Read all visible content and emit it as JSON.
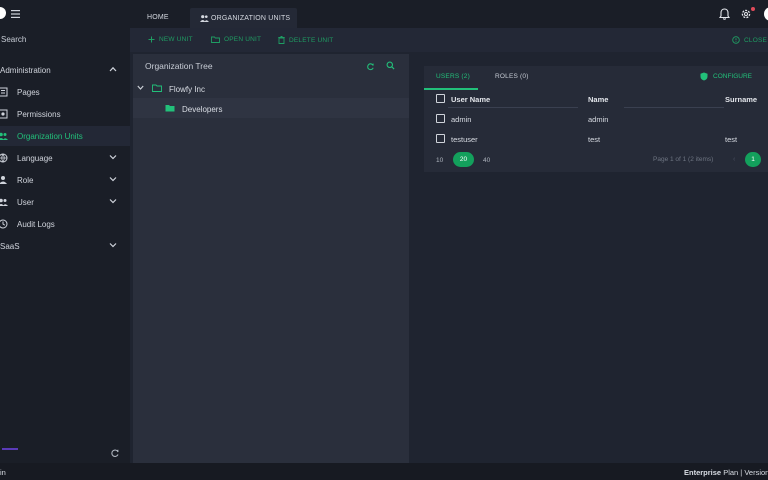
{
  "header": {
    "tabs": [
      {
        "label": "HOME"
      },
      {
        "label": "ORGANIZATION UNITS"
      }
    ]
  },
  "sidebar": {
    "search_label": "Search",
    "items": [
      {
        "label": "Administration",
        "icon": "chevron-up-icon"
      },
      {
        "label": "Pages",
        "icon": "pages-icon"
      },
      {
        "label": "Permissions",
        "icon": "permissions-icon"
      },
      {
        "label": "Organization Units",
        "icon": "org-units-icon",
        "active": true
      },
      {
        "label": "Language",
        "icon": "globe-icon"
      },
      {
        "label": "Role",
        "icon": "role-icon"
      },
      {
        "label": "User",
        "icon": "users-icon"
      },
      {
        "label": "Audit Logs",
        "icon": "clock-icon"
      },
      {
        "label": "SaaS",
        "icon": "chevron-down-icon"
      }
    ]
  },
  "toolbar": {
    "new_unit": "NEW UNIT",
    "open_unit": "OPEN UNIT",
    "delete_unit": "DELETE UNIT",
    "close": "CLOSE"
  },
  "tree": {
    "title": "Organization Tree",
    "nodes": [
      {
        "label": "Flowfy Inc"
      },
      {
        "label": "Developers"
      }
    ]
  },
  "members": {
    "tab_users": "USERS (2)",
    "tab_roles": "ROLES (0)",
    "configure": "CONFIGURE",
    "columns": [
      "User Name",
      "Name",
      "Surname"
    ],
    "rows": [
      {
        "username": "admin",
        "name": "admin",
        "surname": ""
      },
      {
        "username": "testuser",
        "name": "test",
        "surname": "test"
      }
    ],
    "page_sizes": [
      "10",
      "20",
      "40"
    ],
    "page_info": "Page 1 of 1 (2 items)",
    "current_page": "1"
  },
  "footer": {
    "left": "in",
    "plan_bold": "Enterprise",
    "plan_rest": " Plan | Version"
  },
  "colors": {
    "accent": "#22c07a",
    "active_button": "#13a05c",
    "background": "#1f2430",
    "panel": "#2a2f3c"
  }
}
